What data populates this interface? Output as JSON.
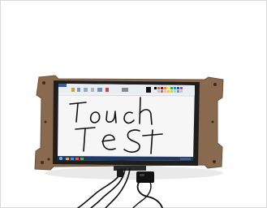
{
  "image": {
    "subject": "touchscreen-monitor",
    "handwriting_line1": "Touch",
    "handwriting_line2": "Test"
  },
  "colors": {
    "bracket": "#8a6a4f",
    "bezel": "#1e1e1e",
    "screen": "#f6f6f6",
    "ribbon": "#e9eef5",
    "taskbar": "#1f3a66",
    "ink": "#111111",
    "cable": "#0d0d0d"
  }
}
